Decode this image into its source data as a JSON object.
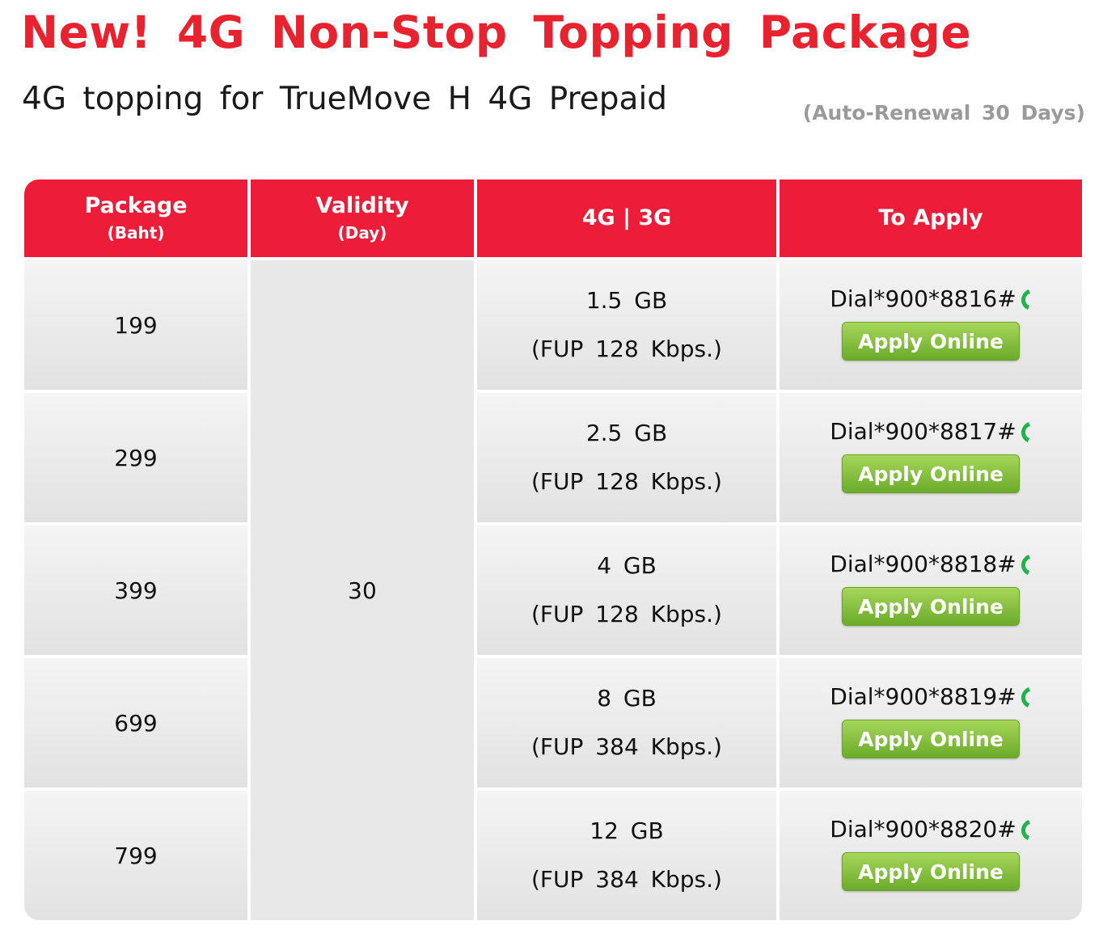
{
  "header": {
    "title": "New! 4G Non-Stop Topping Package",
    "subtitle": "4G topping for TrueMove H 4G Prepaid",
    "renewal_note": "(Auto-Renewal 30 Days)"
  },
  "table": {
    "columns": [
      {
        "label": "Package",
        "sub": "(Baht)"
      },
      {
        "label": "Validity",
        "sub": "(Day)"
      },
      {
        "label": "4G | 3G",
        "sub": ""
      },
      {
        "label": "To Apply",
        "sub": ""
      }
    ],
    "validity_value": "30",
    "rows": [
      {
        "price": "199",
        "data": "1.5 GB",
        "fup": "(FUP 128 Kbps.)",
        "dial": "Dial*900*8816#",
        "button": "Apply Online"
      },
      {
        "price": "299",
        "data": "2.5 GB",
        "fup": "(FUP 128 Kbps.)",
        "dial": "Dial*900*8817#",
        "button": "Apply Online"
      },
      {
        "price": "399",
        "data": "4 GB",
        "fup": "(FUP 128 Kbps.)",
        "dial": "Dial*900*8818#",
        "button": "Apply Online"
      },
      {
        "price": "699",
        "data": "8 GB",
        "fup": "(FUP 384 Kbps.)",
        "dial": "Dial*900*8819#",
        "button": "Apply Online"
      },
      {
        "price": "799",
        "data": "12 GB",
        "fup": "(FUP 384 Kbps.)",
        "dial": "Dial*900*8820#",
        "button": "Apply Online"
      }
    ]
  },
  "icons": {
    "dial": "phone-icon"
  },
  "colors": {
    "brand_red": "#e8222e",
    "header_red": "#ed1c38",
    "button_green": "#7fbf35",
    "phone_green": "#22b24c",
    "note_gray": "#9a9a9a"
  }
}
